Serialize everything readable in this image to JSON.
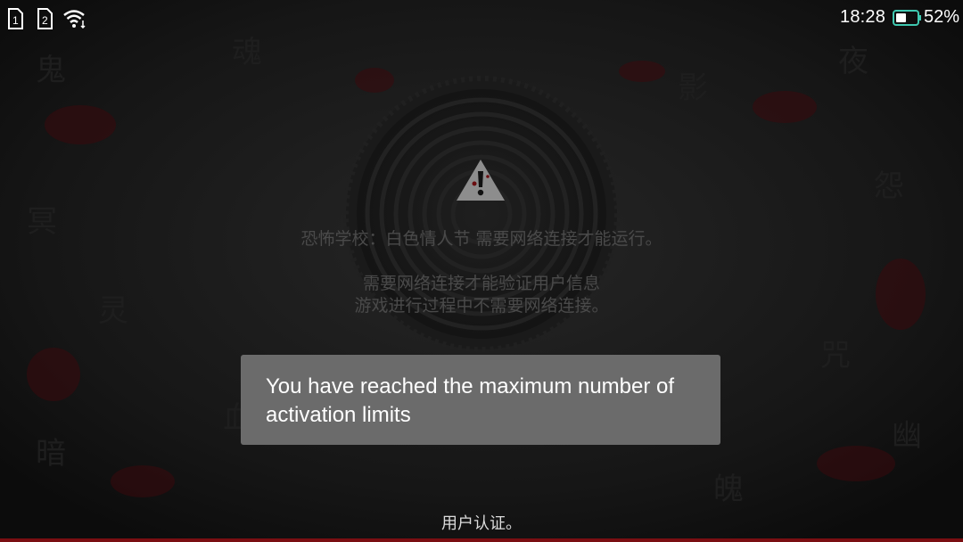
{
  "status_bar": {
    "sim1_label": "1",
    "sim2_label": "2",
    "wifi_icon": "wifi-icon",
    "time": "18:28",
    "battery_icon": "battery-icon",
    "battery_percent": "52%",
    "battery_level": 0.52
  },
  "dialog": {
    "icon": "warning-icon",
    "line1": "恐怖学校：白色情人节 需要网络连接才能运行。",
    "line2": "需要网络连接才能验证用户信息",
    "line3": "游戏进行过程中不需要网络连接。"
  },
  "toast": {
    "text": "You have reached the maximum number of activation limits"
  },
  "footer": {
    "label": "用户认证。"
  },
  "colors": {
    "background": "#141414",
    "accent_red": "#7a0e12",
    "toast_bg": "#6b6b6b",
    "dim_text": "#4a4a4a"
  }
}
